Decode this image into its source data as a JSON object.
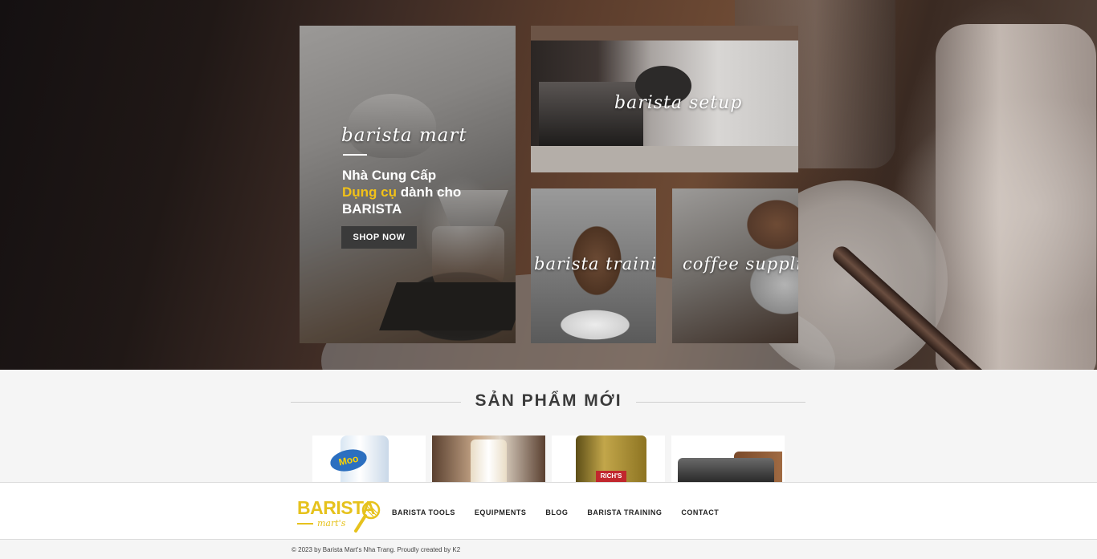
{
  "hero": {
    "brand_script": "barista mart",
    "headline": {
      "line1": "Nhà Cung Cấp",
      "line2_highlight": "Dụng cụ",
      "line2_rest": " dành cho",
      "line3": "BARISTA"
    },
    "shop_button": "SHOP NOW",
    "tiles": {
      "setup": "barista setup",
      "training": "barista training",
      "supplier": "coffee supplier"
    }
  },
  "new_products": {
    "title": "SẢN PHẨM MỚI",
    "items": [
      {
        "label": "Moo"
      },
      {
        "label": ""
      },
      {
        "label": "RICH'S"
      },
      {
        "label": ""
      }
    ]
  },
  "header": {
    "logo": {
      "main": "BARISTA",
      "sub": "mart's"
    },
    "nav": [
      "BARISTA TOOLS",
      "EQUIPMENTS",
      "BLOG",
      "BARISTA TRAINING",
      "CONTACT"
    ]
  },
  "footer": {
    "copyright": "© 2023 by Barista Mart's Nha Trang. Proudly created by K2"
  },
  "colors": {
    "accent_yellow": "#f2c218",
    "logo_yellow": "#e6c21d",
    "button_dark": "#3a3a3a"
  }
}
